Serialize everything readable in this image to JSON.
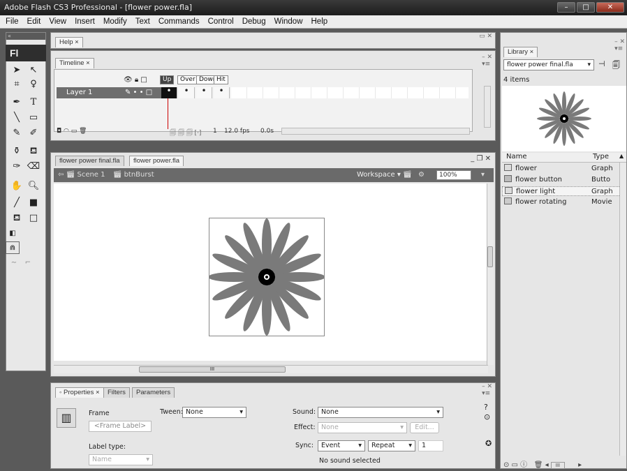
{
  "window": {
    "title": "Adobe Flash CS3 Professional - [flower power.fla]",
    "app_badge": "Fl"
  },
  "menus": [
    "File",
    "Edit",
    "View",
    "Insert",
    "Modify",
    "Text",
    "Commands",
    "Control",
    "Debug",
    "Window",
    "Help"
  ],
  "tools": {
    "logo": "Fl"
  },
  "help_panel": {
    "tab": "Help"
  },
  "timeline": {
    "tab": "Timeline",
    "frame_states": [
      "Up",
      "Over",
      "Down",
      "Hit"
    ],
    "layer_name": "Layer 1",
    "current_frame": "1",
    "fps": "12.0 fps",
    "time": "0.0s"
  },
  "document": {
    "tabs": [
      "flower power final.fla",
      "flower power.fla"
    ],
    "breadcrumb": [
      "Scene 1",
      "btnBurst"
    ],
    "workspace_label": "Workspace",
    "zoom": "100%",
    "scroll_mid": "III"
  },
  "properties": {
    "tabs": [
      "Properties",
      "Filters",
      "Parameters"
    ],
    "frame_label": "Frame",
    "tween_label": "Tween:",
    "tween_value": "None",
    "frame_label_placeholder": "<Frame Label>",
    "label_type_label": "Label type:",
    "label_type_value": "Name",
    "sound_label": "Sound:",
    "sound_value": "None",
    "effect_label": "Effect:",
    "effect_value": "None",
    "edit_button": "Edit...",
    "sync_label": "Sync:",
    "sync_value": "Event",
    "repeat_value": "Repeat",
    "repeat_count": "1",
    "status": "No sound selected"
  },
  "library": {
    "tab": "Library",
    "document": "flower power final.fla",
    "item_count": "4 items",
    "columns": [
      "Name",
      "Type"
    ],
    "items": [
      {
        "name": "flower",
        "type": "Graph"
      },
      {
        "name": "flower button",
        "type": "Butto"
      },
      {
        "name": "flower light",
        "type": "Graph"
      },
      {
        "name": "flower rotating",
        "type": "Movie"
      }
    ]
  }
}
